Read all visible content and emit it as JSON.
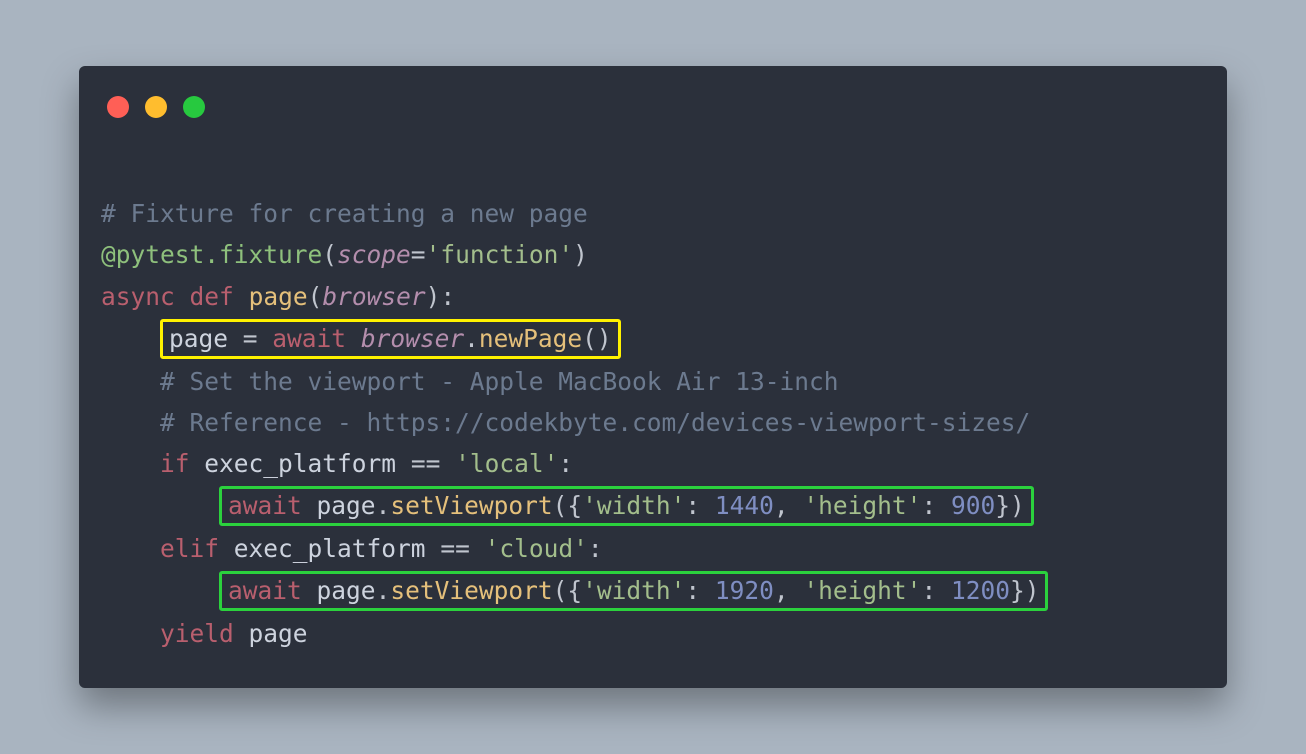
{
  "traffic": {
    "red": "#ff5f56",
    "yellow": "#ffbd2e",
    "green": "#27c93f"
  },
  "code": {
    "l1": "# Fixture for creating a new page",
    "l2": {
      "decor": "@pytest.fixture",
      "open": "(",
      "kw": "scope",
      "eq": "=",
      "str": "'function'",
      "close": ")"
    },
    "l3": {
      "async": "async",
      "def": "def",
      "name": "page",
      "open": "(",
      "param": "browser",
      "close": "):"
    },
    "l4": {
      "lhs": "page",
      "eq": " = ",
      "await": "await",
      "obj": "browser",
      "dot": ".",
      "call": "newPage",
      "parens": "()"
    },
    "l5": "# Set the viewport - Apple MacBook Air 13-inch",
    "l6": "# Reference - https://codekbyte.com/devices-viewport-sizes/",
    "l7": {
      "if": "if",
      "var": "exec_platform",
      "op": " == ",
      "str": "'local'",
      "colon": ":"
    },
    "l8": {
      "await": "await",
      "obj": "page",
      "dot1": ".",
      "fn": "setViewport",
      "open": "({",
      "k1": "'width'",
      "c1": ": ",
      "v1": "1440",
      "sep": ", ",
      "k2": "'height'",
      "c2": ": ",
      "v2": "900",
      "close": "})"
    },
    "l9": {
      "elif": "elif",
      "var": "exec_platform",
      "op": " == ",
      "str": "'cloud'",
      "colon": ":"
    },
    "l10": {
      "await": "await",
      "obj": "page",
      "dot1": ".",
      "fn": "setViewport",
      "open": "({",
      "k1": "'width'",
      "c1": ": ",
      "v1": "1920",
      "sep": ", ",
      "k2": "'height'",
      "c2": ": ",
      "v2": "1200",
      "close": "})"
    },
    "l11": {
      "yield": "yield",
      "val": "page"
    }
  }
}
